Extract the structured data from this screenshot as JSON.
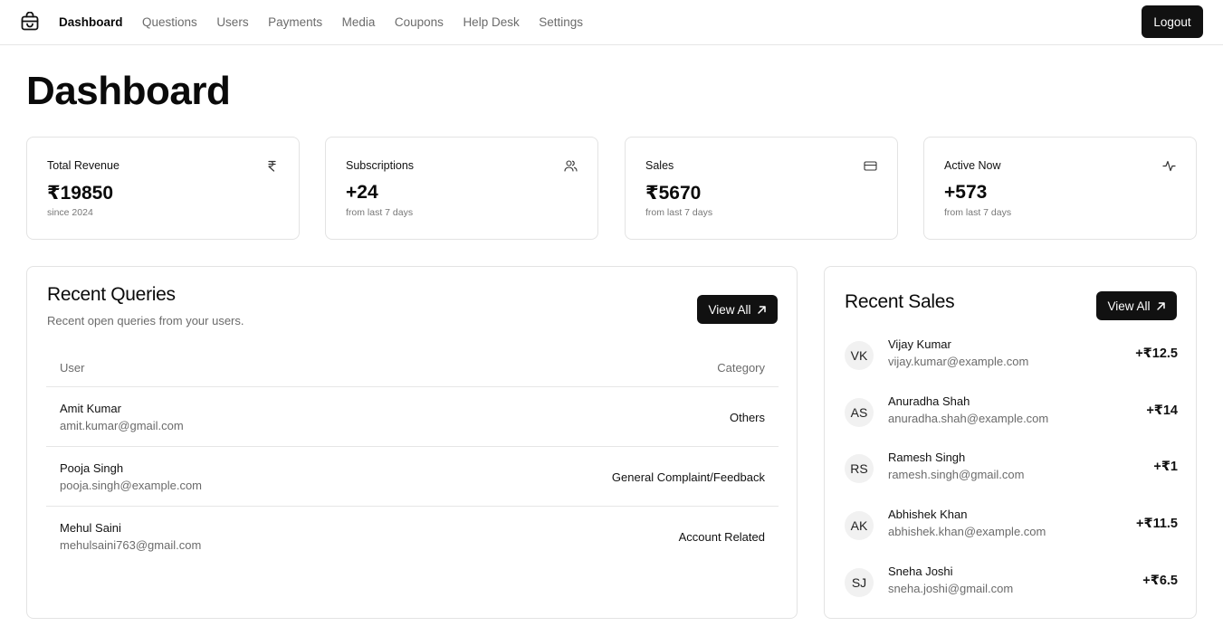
{
  "nav": {
    "logo_icon": "shopping-bag-icon",
    "links": [
      {
        "label": "Dashboard",
        "active": true
      },
      {
        "label": "Questions",
        "active": false
      },
      {
        "label": "Users",
        "active": false
      },
      {
        "label": "Payments",
        "active": false
      },
      {
        "label": "Media",
        "active": false
      },
      {
        "label": "Coupons",
        "active": false
      },
      {
        "label": "Help Desk",
        "active": false
      },
      {
        "label": "Settings",
        "active": false
      }
    ],
    "logout_label": "Logout"
  },
  "page_title": "Dashboard",
  "stats": [
    {
      "label": "Total Revenue",
      "value": "₹19850",
      "sub": "since 2024",
      "icon": "rupee-icon"
    },
    {
      "label": "Subscriptions",
      "value": "+24",
      "sub": "from last 7 days",
      "icon": "users-icon"
    },
    {
      "label": "Sales",
      "value": "₹5670",
      "sub": "from last 7 days",
      "icon": "credit-card-icon"
    },
    {
      "label": "Active Now",
      "value": "+573",
      "sub": "from last 7 days",
      "icon": "activity-icon"
    }
  ],
  "queries": {
    "title": "Recent Queries",
    "description": "Recent open queries from your users.",
    "view_all_label": "View All",
    "columns": [
      "User",
      "Category"
    ],
    "rows": [
      {
        "name": "Amit Kumar",
        "email": "amit.kumar@gmail.com",
        "category": "Others"
      },
      {
        "name": "Pooja Singh",
        "email": "pooja.singh@example.com",
        "category": "General Complaint/Feedback"
      },
      {
        "name": "Mehul Saini",
        "email": "mehulsaini763@gmail.com",
        "category": "Account Related"
      }
    ]
  },
  "sales": {
    "title": "Recent Sales",
    "view_all_label": "View All",
    "items": [
      {
        "initials": "VK",
        "name": "Vijay Kumar",
        "email": "vijay.kumar@example.com",
        "amount": "+₹12.5"
      },
      {
        "initials": "AS",
        "name": "Anuradha Shah",
        "email": "anuradha.shah@example.com",
        "amount": "+₹14"
      },
      {
        "initials": "RS",
        "name": "Ramesh Singh",
        "email": "ramesh.singh@gmail.com",
        "amount": "+₹1"
      },
      {
        "initials": "AK",
        "name": "Abhishek Khan",
        "email": "abhishek.khan@example.com",
        "amount": "+₹11.5"
      },
      {
        "initials": "SJ",
        "name": "Sneha Joshi",
        "email": "sneha.joshi@gmail.com",
        "amount": "+₹6.5"
      }
    ]
  }
}
